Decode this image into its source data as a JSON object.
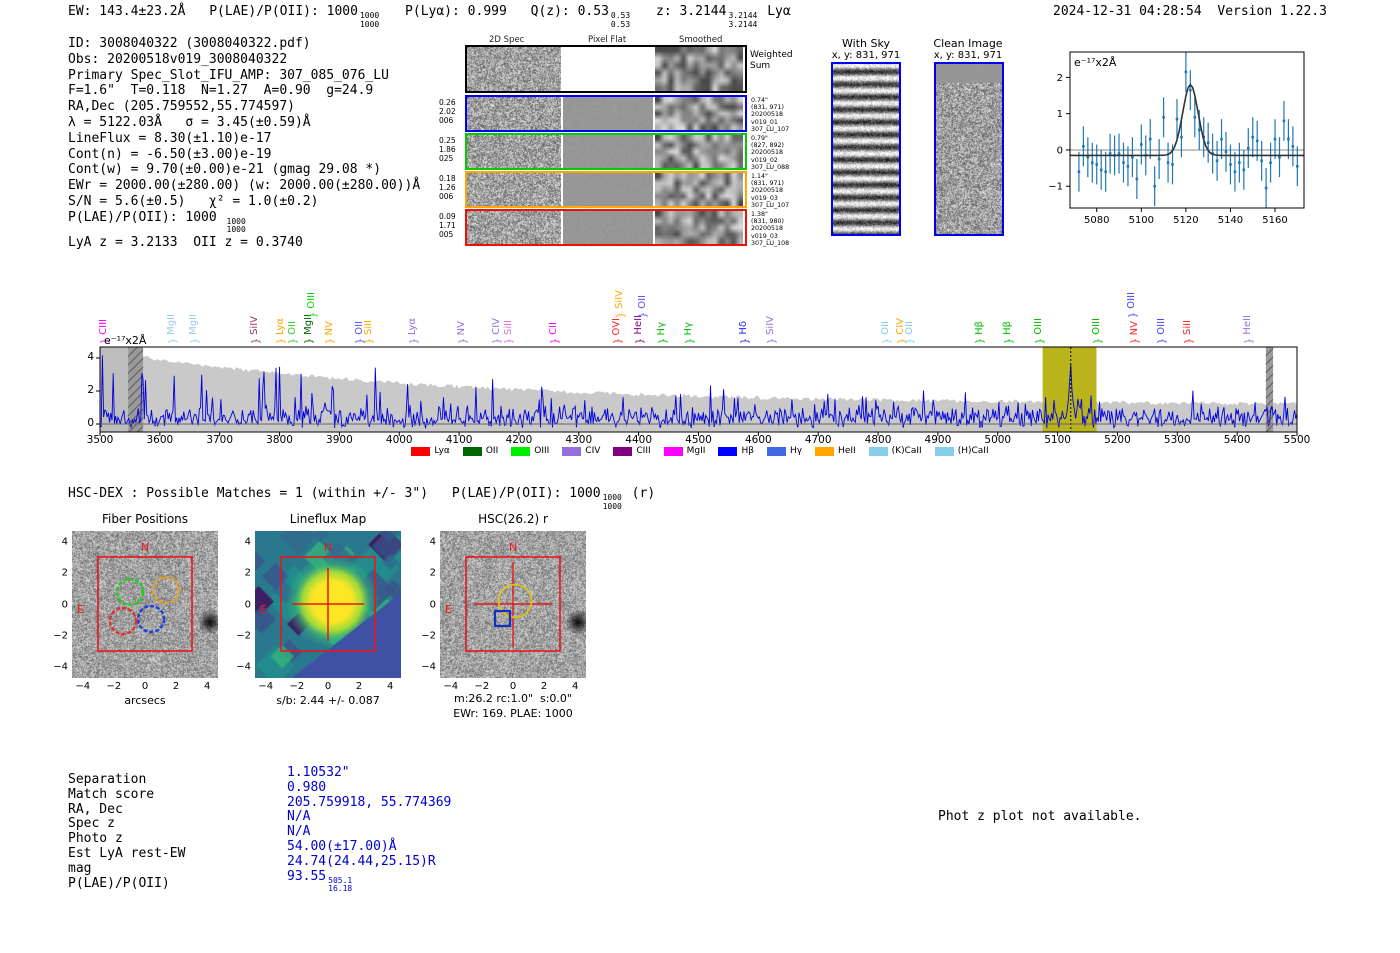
{
  "header": {
    "ew": "EW: 143.4±23.2Å",
    "plae": "P(LAE)/P(OII): 1000",
    "plae_hi": "1000",
    "plae_lo": "1000",
    "plya": "P(Lyα): 0.999",
    "qz": "Q(z): 0.53",
    "qz_hi": "0.53",
    "qz_lo": "0.53",
    "z": "z: 3.2144",
    "z_hi": "3.2144",
    "z_lo": "3.2144",
    "line_type": "Lyα",
    "datetime": "2024-12-31 04:28:54",
    "version": "Version 1.22.3"
  },
  "info": {
    "lines": [
      {
        "t": "ID: 3008040322 (3008040322.pdf)"
      },
      {
        "t": "Obs: 20200518v019_3008040322"
      },
      {
        "t": "Primary Spec_Slot_IFU_AMP: 307_085_076_LU"
      },
      {
        "t": "F=1.6\"  T=0.118  N=1.27  A=0.90  g=24.9"
      },
      {
        "t": "RA,Dec (205.759552,55.774597)"
      },
      {
        "t": "λ = 5122.03Å   σ = 3.45(±0.59)Å"
      },
      {
        "t": "LineFlux = 8.30(±1.10)e-17"
      },
      {
        "t": "Cont(n) = -6.50(±3.00)e-19"
      },
      {
        "t": "Cont(w) = 9.70(±0.00)e-21 (gmag 29.08 *)"
      },
      {
        "t": "EWr = 2000.00(±280.00) (w: 2000.00(±280.00))Å"
      },
      {
        "t": "S/N = 5.6(±0.5)   χ² = 1.0(±0.2)"
      },
      {
        "t": "P(LAE)/P(OII): 1000 ",
        "hi": "1000",
        "lo": "1000"
      },
      {
        "t": "LyA z = 3.2133  OII z = 0.3740"
      }
    ]
  },
  "spec2d": {
    "headers": [
      "2D Spec",
      "Pixel Flat",
      "Smoothed"
    ],
    "weighted_label": "Weighted Sum",
    "rows": [
      {
        "border": "#0000ee",
        "left": [
          "0.26",
          "2.02",
          "006"
        ],
        "right": [
          "0.74\"",
          "(831, 971)",
          "20200518",
          "v019_01",
          "307_LU_107"
        ]
      },
      {
        "border": "#00cc00",
        "left": [
          "0.25",
          "1.86",
          "025"
        ],
        "right": [
          "0.79\"",
          "(827, 892)",
          "20200518",
          "v019_02",
          "307_LU_088"
        ]
      },
      {
        "border": "#ffa500",
        "left": [
          "0.18",
          "1.26",
          "006"
        ],
        "right": [
          "1.14\"",
          "(831, 971)",
          "20200518",
          "v019_03",
          "307_LU_107"
        ]
      },
      {
        "border": "#ee1100",
        "left": [
          "0.09",
          "1.71",
          "005"
        ],
        "right": [
          "1.38\"",
          "(831, 980)",
          "20200518",
          "v019_03",
          "307_LU_108"
        ]
      }
    ]
  },
  "sky_panels": {
    "with_sky": {
      "title": "With Sky",
      "subtitle": "x, y: 831, 971"
    },
    "clean": {
      "title": "Clean Image",
      "subtitle": "x, y: 831, 971"
    }
  },
  "hscdex": {
    "text": "HSC-DEX : Possible Matches = 1 (within +/- 3\")",
    "plae": "P(LAE)/P(OII): 1000",
    "plae_hi": "1000",
    "plae_lo": "1000",
    "suffix": "(r)"
  },
  "cutouts": {
    "ticks": [
      "−4",
      "−2",
      "0",
      "2",
      "4"
    ],
    "tick_vals": [
      -4,
      -2,
      0,
      2,
      4
    ],
    "fiber": {
      "title": "Fiber Positions",
      "xlabel": "arcsecs",
      "n": "N",
      "e": "E"
    },
    "lineflux": {
      "title": "Lineflux Map",
      "xlabel": "s/b: 2.44 +/- 0.087",
      "n": "N",
      "e": "E"
    },
    "hsc": {
      "title": "HSC(26.2) r",
      "xlabel1": "m:26.2 rc:1.0\"  s:0.0\"",
      "xlabel2": "EWr: 169. PLAE: 1000",
      "n": "N",
      "e": "E"
    }
  },
  "match_table": {
    "rows": [
      {
        "label": "Separation",
        "value": "1.10532\""
      },
      {
        "label": "Match score",
        "value": "0.980"
      },
      {
        "label": "RA, Dec",
        "value": "205.759918, 55.774369"
      },
      {
        "label": "Spec z",
        "value": "N/A"
      },
      {
        "label": "Photo z",
        "value": "N/A"
      },
      {
        "label": "Est LyA rest-EW",
        "value": "54.00(±17.00)Å"
      },
      {
        "label": "mag",
        "value": "24.74(24.44,25.15)R"
      },
      {
        "label": "P(LAE)/P(OII)",
        "value": "93.55",
        "frac_hi": "505.1",
        "frac_lo": "16.18"
      }
    ]
  },
  "photz_note": "Phot z plot not available.",
  "chart_data": [
    {
      "id": "line_fit",
      "type": "scatter",
      "title": "Emission line fit at 5122.03Å",
      "unit_label": "e⁻¹⁷x2Å",
      "xlim": [
        5068,
        5173
      ],
      "ylim": [
        -1.6,
        2.7
      ],
      "xticks": [
        5080,
        5100,
        5120,
        5140,
        5160
      ],
      "yticks": [
        -1,
        0,
        1,
        2
      ],
      "yerr": 0.55,
      "x": [
        5072,
        5074,
        5076,
        5078,
        5080,
        5082,
        5084,
        5086,
        5088,
        5090,
        5092,
        5094,
        5096,
        5098,
        5100,
        5102,
        5104,
        5106,
        5108,
        5110,
        5112,
        5114,
        5116,
        5118,
        5120,
        5122,
        5124,
        5126,
        5128,
        5130,
        5132,
        5134,
        5136,
        5138,
        5140,
        5142,
        5144,
        5146,
        5148,
        5150,
        5152,
        5154,
        5156,
        5158,
        5160,
        5162,
        5164,
        5166,
        5168,
        5170
      ],
      "y": [
        -0.6,
        0.1,
        -0.2,
        -0.35,
        -0.4,
        -0.55,
        -0.6,
        -0.1,
        -0.15,
        -0.1,
        -0.35,
        -0.45,
        -0.2,
        -0.8,
        0.15,
        -0.15,
        0.3,
        -1.0,
        -0.25,
        0.9,
        -0.35,
        -0.4,
        0.85,
        0.35,
        2.15,
        1.65,
        0.9,
        0.55,
        0.35,
        0.2,
        -0.1,
        -0.3,
        0.3,
        -0.05,
        -0.4,
        -0.6,
        -0.35,
        -0.55,
        0.05,
        0.35,
        0.25,
        -0.3,
        -1.05,
        -0.35,
        0.3,
        -0.2,
        0.8,
        0.3,
        0.1,
        -0.45
      ],
      "fit": {
        "type": "gaussian",
        "center": 5122.03,
        "sigma": 3.45,
        "amplitude": 1.95,
        "baseline": -0.15
      }
    },
    {
      "id": "full_spectrum",
      "type": "line",
      "title": "Full HETDEX spectrum",
      "unit_label": "e⁻¹⁷x2Å",
      "xlim": [
        3500,
        5500
      ],
      "xticks": [
        3500,
        3600,
        3700,
        3800,
        3900,
        4000,
        4100,
        4200,
        4300,
        4400,
        4500,
        4600,
        4700,
        4800,
        4900,
        5000,
        5100,
        5200,
        5300,
        5400,
        5500
      ],
      "yticks": [
        0,
        2,
        4
      ],
      "emission": {
        "center": 5122,
        "sigma": 3.4,
        "amplitude": 2.1
      },
      "highlight_band": [
        5075,
        5165
      ],
      "dashed_line_at": 5122,
      "masked_bands": [
        [
          3500,
          3547
        ],
        [
          3547,
          3572
        ],
        [
          5448,
          5460
        ]
      ],
      "envelope": {
        "base": 1.15,
        "amp": 3.3,
        "tau": 550
      },
      "noise_seed": 20200518,
      "legend": [
        {
          "label": "Lyα",
          "color": "#ff0000"
        },
        {
          "label": "OII",
          "color": "#006400"
        },
        {
          "label": "OIII",
          "color": "#00ee00"
        },
        {
          "label": "CIV",
          "color": "#9370db"
        },
        {
          "label": "CIII",
          "color": "#800080"
        },
        {
          "label": "MgII",
          "color": "#ff00ff"
        },
        {
          "label": "Hβ",
          "color": "#0000ff"
        },
        {
          "label": "Hγ",
          "color": "#4169e1"
        },
        {
          "label": "HeII",
          "color": "#ffa500"
        },
        {
          "label": "(K)CaII",
          "color": "#87ceeb"
        },
        {
          "label": "(H)CaII",
          "color": "#87ceeb"
        }
      ],
      "line_labels": [
        {
          "name": "CIII",
          "wave": 3510,
          "color": "#ff00ff",
          "high": false
        },
        {
          "name": "MgII",
          "wave": 3624,
          "color": "#99ccee",
          "high": false
        },
        {
          "name": "MgII",
          "wave": 3661,
          "color": "#99ccee",
          "high": false
        },
        {
          "name": "SiIV",
          "wave": 3763,
          "color": "#993366",
          "high": false
        },
        {
          "name": "Lyα",
          "wave": 3805,
          "color": "#ffa500",
          "high": false
        },
        {
          "name": "OII",
          "wave": 3825,
          "color": "#33cc33",
          "high": false
        },
        {
          "name": "MgII",
          "wave": 3852,
          "color": "#006400",
          "high": false
        },
        {
          "name": "OIII",
          "wave": 3858,
          "color": "#00dd00",
          "high": true
        },
        {
          "name": "NV",
          "wave": 3887,
          "color": "#ffa500",
          "high": false
        },
        {
          "name": "OII",
          "wave": 3937,
          "color": "#5555ff",
          "high": false
        },
        {
          "name": "SiII",
          "wave": 3952,
          "color": "#ffa500",
          "high": false
        },
        {
          "name": "Lyα",
          "wave": 4027,
          "color": "#9370db",
          "high": false
        },
        {
          "name": "NV",
          "wave": 4108,
          "color": "#9370db",
          "high": false
        },
        {
          "name": "CIV",
          "wave": 4166,
          "color": "#9370db",
          "high": false
        },
        {
          "name": "SiII",
          "wave": 4186,
          "color": "#da70d6",
          "high": false
        },
        {
          "name": "CII",
          "wave": 4262,
          "color": "#ff00ff",
          "high": false
        },
        {
          "name": "OVI",
          "wave": 4367,
          "color": "#ff2222",
          "high": false
        },
        {
          "name": "SiIV",
          "wave": 4372,
          "color": "#ffa500",
          "high": true
        },
        {
          "name": "HeII",
          "wave": 4404,
          "color": "#880088",
          "high": false
        },
        {
          "name": "OII",
          "wave": 4410,
          "color": "#5555ff",
          "high": true
        },
        {
          "name": "Hγ",
          "wave": 4442,
          "color": "#00bb00",
          "high": false
        },
        {
          "name": "Hγ",
          "wave": 4487,
          "color": "#00bb00",
          "high": false
        },
        {
          "name": "Hδ",
          "wave": 4580,
          "color": "#2222ff",
          "high": false
        },
        {
          "name": "SiIV",
          "wave": 4625,
          "color": "#9370db",
          "high": false
        },
        {
          "name": "OII",
          "wave": 4817,
          "color": "#87ceeb",
          "high": false
        },
        {
          "name": "CIV",
          "wave": 4842,
          "color": "#ffa500",
          "high": false
        },
        {
          "name": "OII",
          "wave": 4856,
          "color": "#87ceeb",
          "high": false
        },
        {
          "name": "Hβ",
          "wave": 4973,
          "color": "#00bb00",
          "high": false
        },
        {
          "name": "Hβ",
          "wave": 5020,
          "color": "#00bb00",
          "high": false
        },
        {
          "name": "OIII",
          "wave": 5073,
          "color": "#00bb00",
          "high": false
        },
        {
          "name": "OIII",
          "wave": 5170,
          "color": "#00bb00",
          "high": false
        },
        {
          "name": "OIII",
          "wave": 5228,
          "color": "#4444ff",
          "high": true
        },
        {
          "name": "NV",
          "wave": 5232,
          "color": "#ff2222",
          "high": false
        },
        {
          "name": "OIII",
          "wave": 5277,
          "color": "#4444ff",
          "high": false
        },
        {
          "name": "SiII",
          "wave": 5322,
          "color": "#ff2222",
          "high": false
        },
        {
          "name": "HeII",
          "wave": 5422,
          "color": "#9370db",
          "high": false
        }
      ]
    }
  ]
}
